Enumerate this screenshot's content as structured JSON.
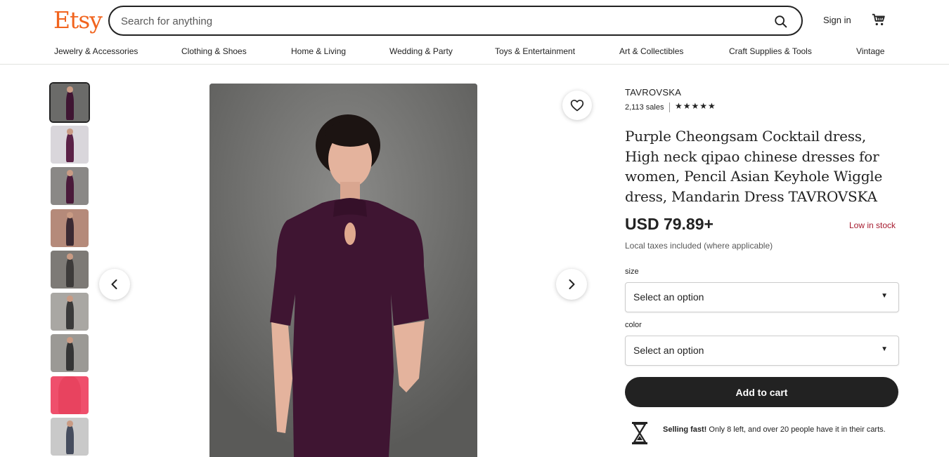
{
  "header": {
    "logo": "Etsy",
    "search_placeholder": "Search for anything",
    "signin_label": "Sign in"
  },
  "nav": {
    "items": [
      "Jewelry & Accessories",
      "Clothing & Shoes",
      "Home & Living",
      "Wedding & Party",
      "Toys & Entertainment",
      "Art & Collectibles",
      "Craft Supplies & Tools",
      "Vintage"
    ]
  },
  "colors": {
    "brand": "#f1641e",
    "dress": "#3f1532",
    "stock_warning": "#a61a2e"
  },
  "product": {
    "shop_name": "TAVROVSKA",
    "sales": "2,113 sales",
    "stars": "★★★★★",
    "title": "Purple Cheongsam Cocktail dress, High neck qipao chinese dresses for women, Pencil Asian Keyhole Wiggle dress, Mandarin Dress TAVROVSKA",
    "price": "USD 79.89+",
    "stock": "Low in stock",
    "taxes": "Local taxes included (where applicable)",
    "size_label": "size",
    "size_value": "Select an option",
    "color_label": "color",
    "color_value": "Select an option",
    "add_to_cart": "Add to cart",
    "selling_fast_bold": "Selling fast!",
    "selling_fast_text": " Only 8 left, and over 20 people have it in their carts."
  }
}
